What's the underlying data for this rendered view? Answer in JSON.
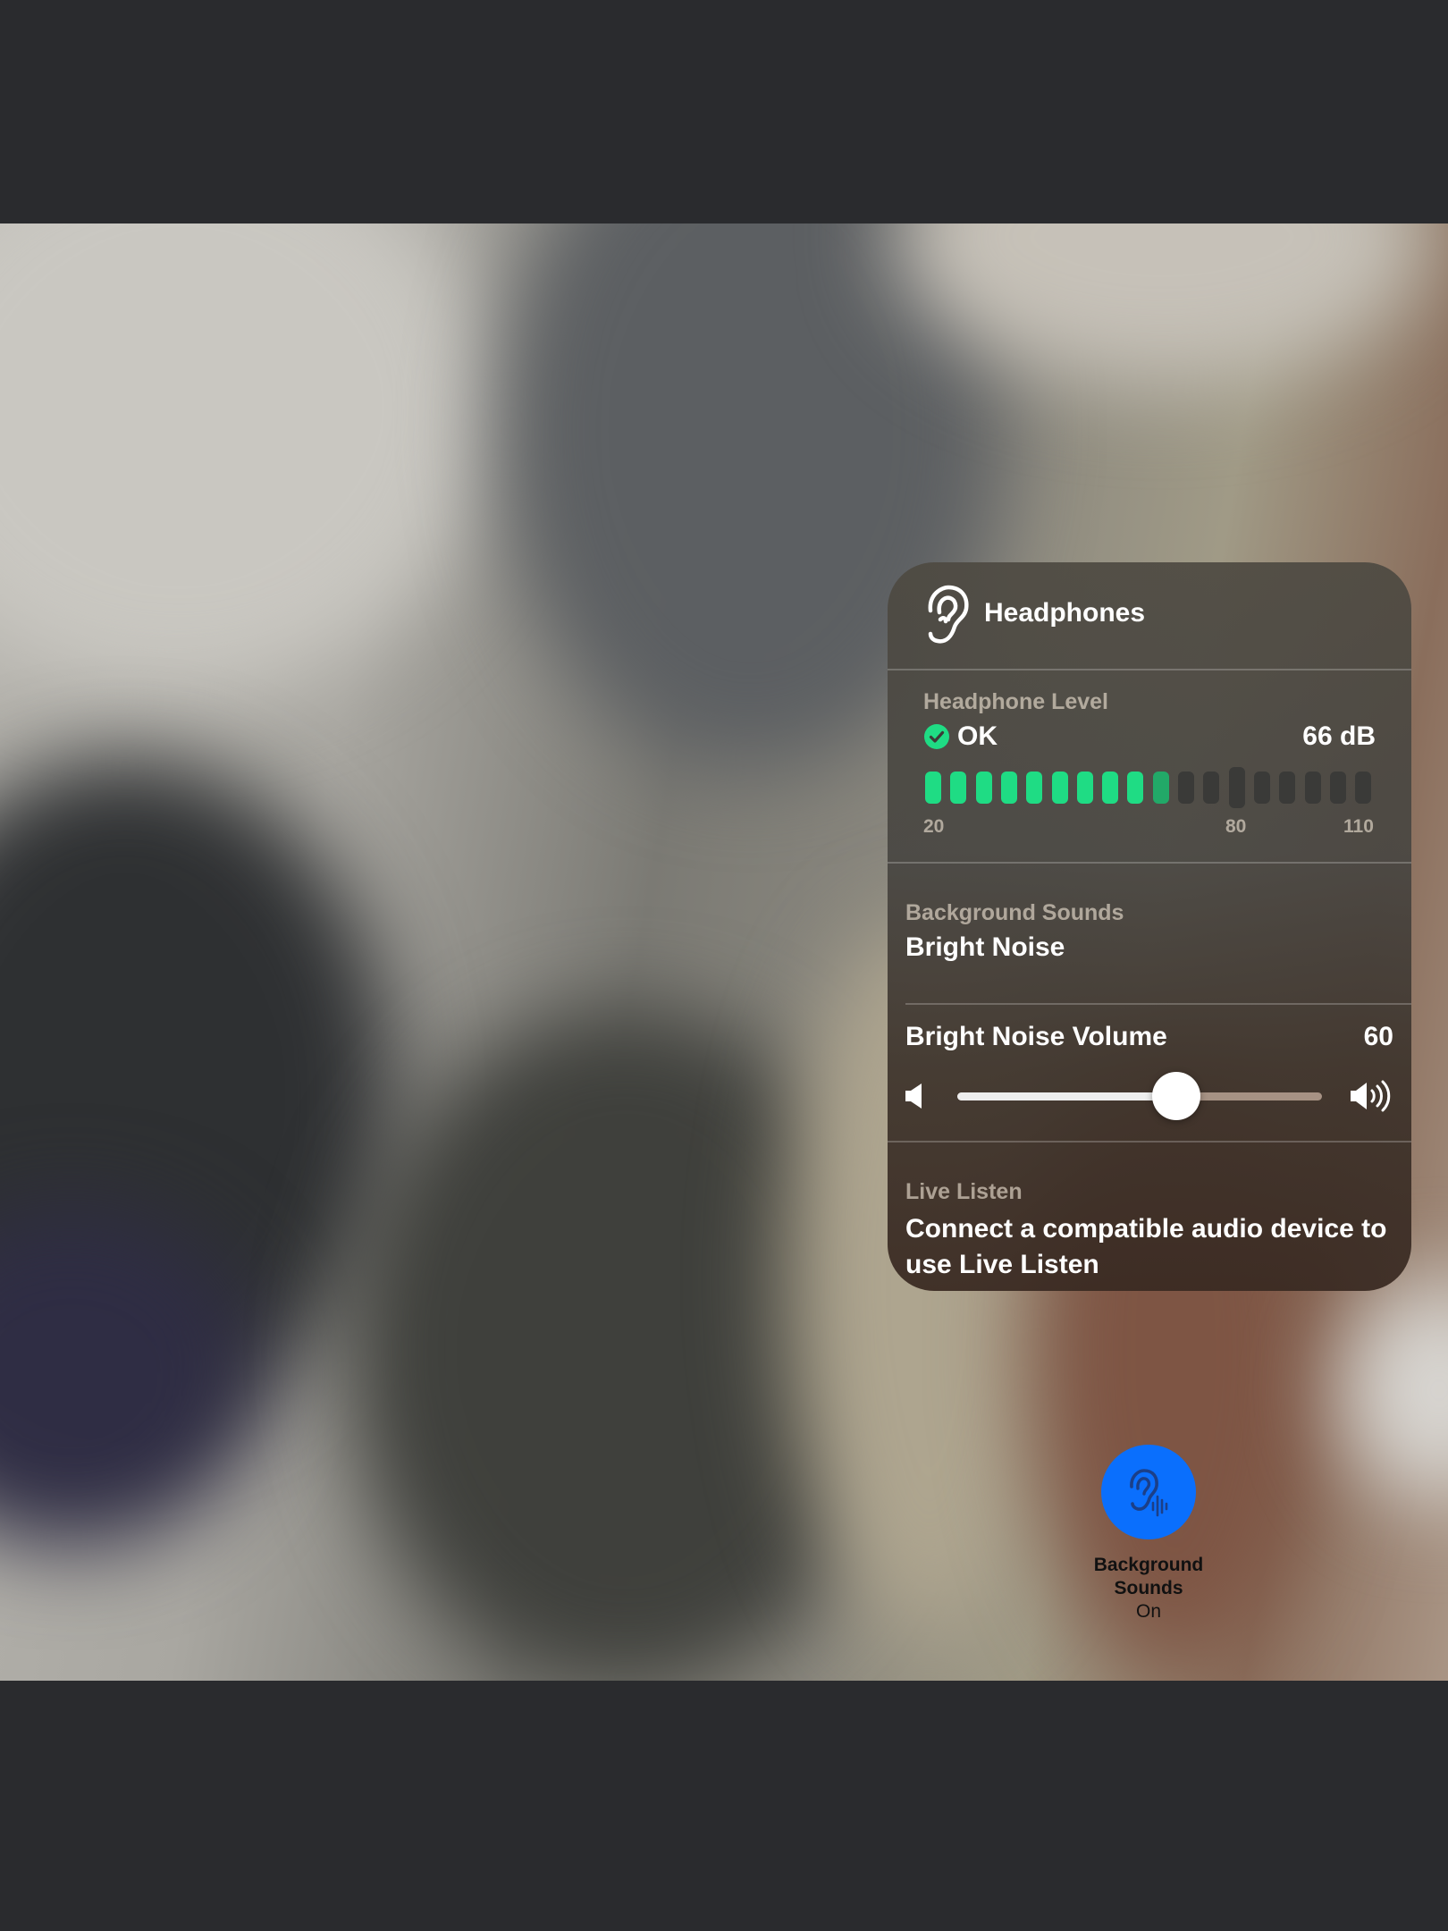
{
  "panel": {
    "title": "Headphones",
    "headphone_level": {
      "label": "Headphone Level",
      "status": "OK",
      "value": "66 dB",
      "ticks": [
        "20",
        "80",
        "110"
      ],
      "segments_total": 18,
      "segments_lit": 10,
      "lit_color": "#1fdc84",
      "dim_color": "#22a968",
      "unlit_color": "#3a3a38"
    },
    "background_sounds": {
      "label": "Background Sounds",
      "value": "Bright Noise"
    },
    "volume": {
      "label": "Bright Noise Volume",
      "value": "60",
      "slider_fraction": 0.6
    },
    "live_listen": {
      "label": "Live Listen",
      "value": "Connect a compatible audio device to use Live Listen"
    }
  },
  "toggle": {
    "label": "Background Sounds",
    "state": "On",
    "color": "#0a6ffd",
    "icon": "ear-sound-icon"
  }
}
